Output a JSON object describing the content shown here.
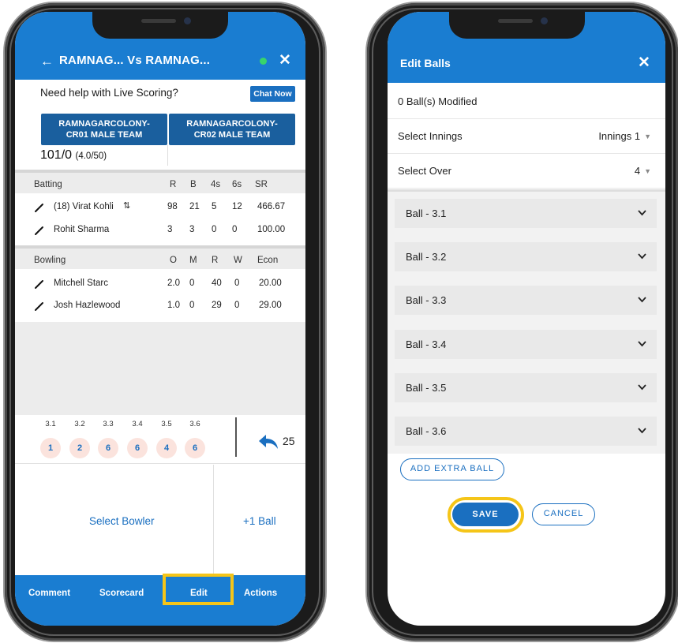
{
  "left": {
    "header": {
      "title": "RAMNAG... Vs  RAMNAG..."
    },
    "help": {
      "text": "Need help with Live Scoring?",
      "chat_label": "Chat Now"
    },
    "teams": [
      {
        "line1": "RAMNAGARCOLONY-",
        "line2": "CR01 MALE TEAM"
      },
      {
        "line1": "RAMNAGARCOLONY-",
        "line2": "CR02 MALE TEAM"
      }
    ],
    "score": {
      "runs": "101/0",
      "overs": "(4.0/50)"
    },
    "batting": {
      "headers": [
        "Batting",
        "R",
        "B",
        "4s",
        "6s",
        "SR"
      ],
      "rows": [
        {
          "name": "(18) Virat Kohli",
          "r": "98",
          "b": "21",
          "fours": "5",
          "sixes": "12",
          "sr": "466.67"
        },
        {
          "name": "Rohit Sharma",
          "r": "3",
          "b": "3",
          "fours": "0",
          "sixes": "0",
          "sr": "100.00"
        }
      ]
    },
    "bowling": {
      "headers": [
        "Bowling",
        "O",
        "M",
        "R",
        "W",
        "Econ"
      ],
      "rows": [
        {
          "name": "Mitchell Starc",
          "o": "2.0",
          "m": "0",
          "r": "40",
          "w": "0",
          "econ": "20.00"
        },
        {
          "name": "Josh Hazlewood",
          "o": "1.0",
          "m": "0",
          "r": "29",
          "w": "0",
          "econ": "29.00"
        }
      ]
    },
    "over_balls": [
      {
        "label": "3.1",
        "runs": "1"
      },
      {
        "label": "3.2",
        "runs": "2"
      },
      {
        "label": "3.3",
        "runs": "6"
      },
      {
        "label": "3.4",
        "runs": "6"
      },
      {
        "label": "3.5",
        "runs": "4"
      },
      {
        "label": "3.6",
        "runs": "6"
      }
    ],
    "undo_count": "25",
    "actions": {
      "select_bowler": "Select Bowler",
      "plus_ball": "+1 Ball"
    },
    "nav": {
      "comment": "Comment",
      "scorecard": "Scorecard",
      "edit": "Edit",
      "actions": "Actions"
    }
  },
  "right": {
    "header": {
      "title": "Edit Balls"
    },
    "modified": "0 Ball(s) Modified",
    "select_innings": {
      "label": "Select Innings",
      "value": "Innings 1"
    },
    "select_over": {
      "label": "Select Over",
      "value": "4"
    },
    "balls": [
      "Ball - 3.1",
      "Ball - 3.2",
      "Ball - 3.3",
      "Ball - 3.4",
      "Ball - 3.5",
      "Ball - 3.6"
    ],
    "add_extra": "ADD EXTRA BALL",
    "save": "SAVE",
    "cancel": "CANCEL"
  },
  "colors": {
    "primary": "#1a7dd1",
    "button": "#1a6fc0",
    "highlight": "#f5c518",
    "ball_bg": "#fbe3dd"
  }
}
